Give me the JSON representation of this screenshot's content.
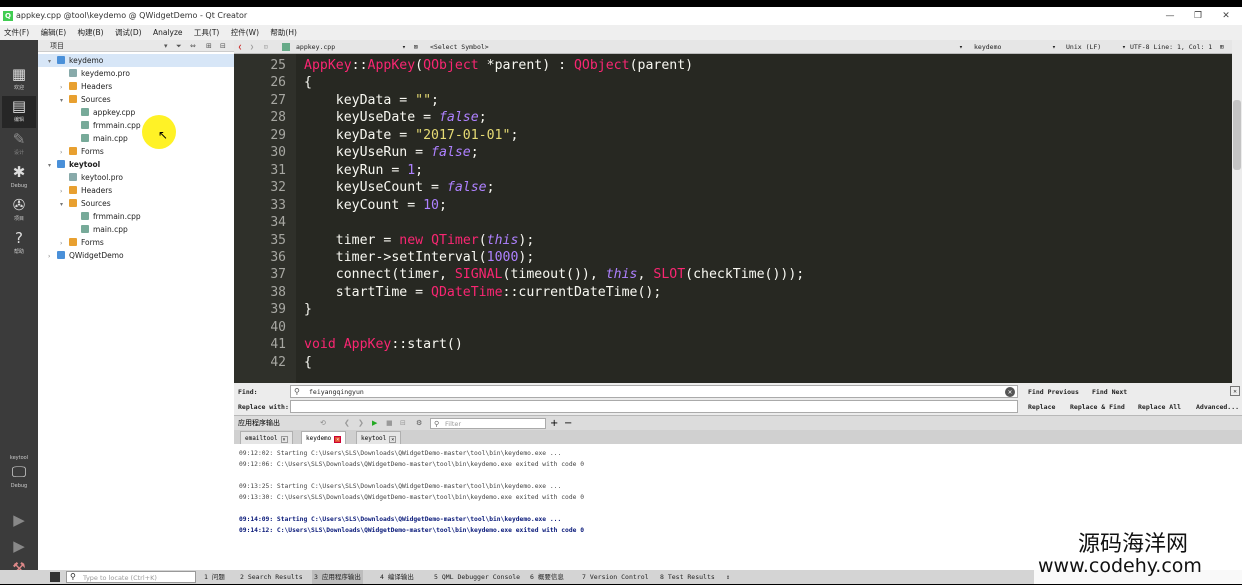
{
  "window": {
    "title": "appkey.cpp @tool\\keydemo @ QWidgetDemo - Qt Creator",
    "minimize": "—",
    "maximize": "❐",
    "close": "✕"
  },
  "menu": [
    "文件(F)",
    "编辑(E)",
    "构建(B)",
    "调试(D)",
    "Analyze",
    "工具(T)",
    "控件(W)",
    "帮助(H)"
  ],
  "modes": [
    {
      "icon": "▦",
      "label": "欢迎"
    },
    {
      "icon": "▤",
      "label": "编辑"
    },
    {
      "icon": "✎",
      "label": "设计"
    },
    {
      "icon": "✱",
      "label": "Debug"
    },
    {
      "icon": "✇",
      "label": "项目"
    },
    {
      "icon": "?",
      "label": "帮助"
    }
  ],
  "kit": {
    "label": "keytool",
    "sub": "Debug"
  },
  "project": {
    "header": "项目",
    "rows": [
      {
        "arrow": "▾",
        "label": "keydemo",
        "indent": 0,
        "icon": "#4a90d9",
        "bold": false
      },
      {
        "arrow": "",
        "label": "keydemo.pro",
        "indent": 1,
        "icon": "#8aa"
      },
      {
        "arrow": "›",
        "label": "Headers",
        "indent": 1,
        "icon": "#e8a030"
      },
      {
        "arrow": "▾",
        "label": "Sources",
        "indent": 1,
        "icon": "#e8a030"
      },
      {
        "arrow": "",
        "label": "appkey.cpp",
        "indent": 2,
        "icon": "#7a9"
      },
      {
        "arrow": "",
        "label": "frmmain.cpp",
        "indent": 2,
        "icon": "#7a9"
      },
      {
        "arrow": "",
        "label": "main.cpp",
        "indent": 2,
        "icon": "#7a9"
      },
      {
        "arrow": "›",
        "label": "Forms",
        "indent": 1,
        "icon": "#e8a030"
      },
      {
        "arrow": "▾",
        "label": "keytool",
        "indent": 0,
        "icon": "#4a90d9",
        "bold": true
      },
      {
        "arrow": "",
        "label": "keytool.pro",
        "indent": 1,
        "icon": "#8aa"
      },
      {
        "arrow": "›",
        "label": "Headers",
        "indent": 1,
        "icon": "#e8a030"
      },
      {
        "arrow": "▾",
        "label": "Sources",
        "indent": 1,
        "icon": "#e8a030"
      },
      {
        "arrow": "",
        "label": "frmmain.cpp",
        "indent": 2,
        "icon": "#7a9"
      },
      {
        "arrow": "",
        "label": "main.cpp",
        "indent": 2,
        "icon": "#7a9"
      },
      {
        "arrow": "›",
        "label": "Forms",
        "indent": 1,
        "icon": "#e8a030"
      },
      {
        "arrow": "›",
        "label": "QWidgetDemo",
        "indent": 0,
        "icon": "#4a90d9"
      }
    ]
  },
  "editor": {
    "file": "appkey.cpp",
    "symbol": "<Select Symbol>",
    "kit": "keydemo",
    "eol": "Unix (LF)",
    "encoding": "UTF-8 Line: 1, Col: 1",
    "lines": [
      {
        "n": "25",
        "html": "<span class=\"kw\">AppKey</span>::<span class=\"kw\">AppKey</span>(<span class=\"ty\">QObject</span> *parent) : <span class=\"ty\">QObject</span>(parent)"
      },
      {
        "n": "26",
        "html": "{"
      },
      {
        "n": "27",
        "html": "    keyData = <span class=\"st\">\"\"</span>;"
      },
      {
        "n": "28",
        "html": "    keyUseDate = <span class=\"bo\">false</span>;"
      },
      {
        "n": "29",
        "html": "    keyDate = <span class=\"st\">\"2017-01-01\"</span>;"
      },
      {
        "n": "30",
        "html": "    keyUseRun = <span class=\"bo\">false</span>;"
      },
      {
        "n": "31",
        "html": "    keyRun = <span class=\"nm\">1</span>;"
      },
      {
        "n": "32",
        "html": "    keyUseCount = <span class=\"bo\">false</span>;"
      },
      {
        "n": "33",
        "html": "    keyCount = <span class=\"nm\">10</span>;"
      },
      {
        "n": "34",
        "html": ""
      },
      {
        "n": "35",
        "html": "    timer = <span class=\"kw\">new</span> <span class=\"ty\">QTimer</span>(<span class=\"bo\">this</span>);"
      },
      {
        "n": "36",
        "html": "    timer-&gt;setInterval(<span class=\"nm\">1000</span>);"
      },
      {
        "n": "37",
        "html": "    connect(timer, <span class=\"mc\">SIGNAL</span>(timeout()), <span class=\"bo\">this</span>, <span class=\"mc\">SLOT</span>(checkTime()));"
      },
      {
        "n": "38",
        "html": "    startTime = <span class=\"ty\">QDateTime</span>::currentDateTime();"
      },
      {
        "n": "39",
        "html": "}"
      },
      {
        "n": "40",
        "html": ""
      },
      {
        "n": "41",
        "html": "<span class=\"kw\">void</span> <span class=\"kw\">AppKey</span>::start()"
      },
      {
        "n": "42",
        "html": "{"
      }
    ]
  },
  "find": {
    "find_label": "Find:",
    "replace_label": "Replace with:",
    "find_value": "feiyangqingyun",
    "find_prev": "Find Previous",
    "find_next": "Find Next",
    "replace": "Replace",
    "replace_find": "Replace & Find",
    "replace_all": "Replace All",
    "advanced": "Advanced..."
  },
  "output": {
    "title": "应用程序输出",
    "filter_placeholder": "Filter",
    "tabs": [
      "emailtool",
      "keydemo",
      "keytool"
    ],
    "lines": [
      {
        "text": "09:12:02: Starting C:\\Users\\SLS\\Downloads\\QWidgetDemo-master\\tool\\bin\\keydemo.exe ...",
        "bold": false
      },
      {
        "text": "09:12:06: C:\\Users\\SLS\\Downloads\\QWidgetDemo-master\\tool\\bin\\keydemo.exe exited with code 0",
        "bold": false
      },
      {
        "text": "",
        "bold": false
      },
      {
        "text": "09:13:25: Starting C:\\Users\\SLS\\Downloads\\QWidgetDemo-master\\tool\\bin\\keydemo.exe ...",
        "bold": false
      },
      {
        "text": "09:13:30: C:\\Users\\SLS\\Downloads\\QWidgetDemo-master\\tool\\bin\\keydemo.exe exited with code 0",
        "bold": false
      },
      {
        "text": "",
        "bold": false
      },
      {
        "text": "09:14:09: Starting C:\\Users\\SLS\\Downloads\\QWidgetDemo-master\\tool\\bin\\keydemo.exe ...",
        "bold": true
      },
      {
        "text": "09:14:12: C:\\Users\\SLS\\Downloads\\QWidgetDemo-master\\tool\\bin\\keydemo.exe exited with code 0",
        "bold": true
      }
    ]
  },
  "status": {
    "locate_placeholder": "Type to locate (Ctrl+K)",
    "panes": [
      "1 问题",
      "2 Search Results",
      "3 应用程序输出",
      "4 编译输出",
      "5 QML Debugger Console",
      "6 概要信息",
      "7 Version Control",
      "8 Test Results"
    ]
  },
  "watermark": {
    "line1": "源码海洋网",
    "line2": "www.codehy.com"
  }
}
